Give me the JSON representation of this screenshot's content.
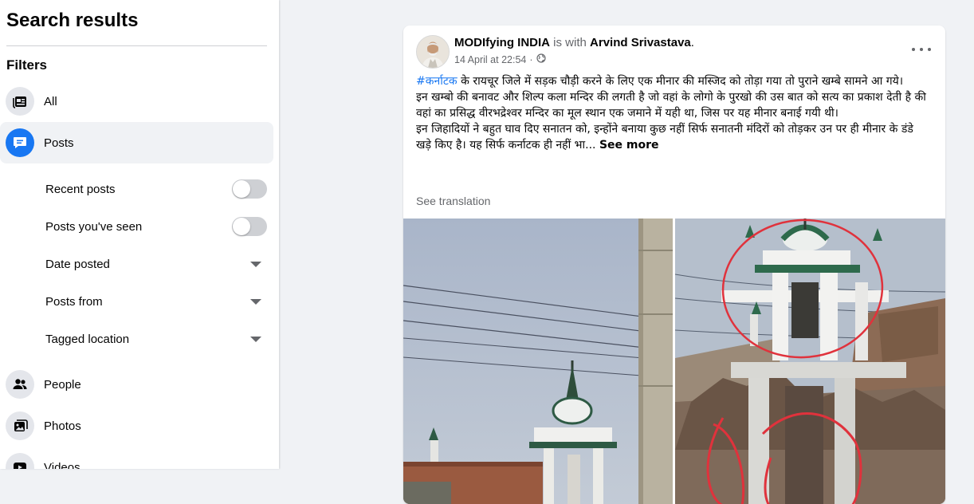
{
  "sidebar": {
    "title": "Search results",
    "filters_heading": "Filters",
    "categories": [
      {
        "label": "All",
        "icon": "feed-icon"
      },
      {
        "label": "Posts",
        "icon": "posts-icon"
      },
      {
        "label": "People",
        "icon": "people-icon"
      },
      {
        "label": "Photos",
        "icon": "photos-icon"
      },
      {
        "label": "Videos",
        "icon": "videos-icon"
      }
    ],
    "post_filters": [
      {
        "label": "Recent posts",
        "control": "toggle",
        "value": "off"
      },
      {
        "label": "Posts you've seen",
        "control": "toggle",
        "value": "off"
      },
      {
        "label": "Date posted",
        "control": "dropdown"
      },
      {
        "label": "Posts from",
        "control": "dropdown"
      },
      {
        "label": "Tagged location",
        "control": "dropdown"
      }
    ]
  },
  "post": {
    "author": "MODIfying INDIA",
    "with_text": "is with",
    "tagged": "Arvind Srivastava",
    "timestamp": "14 April at 22:54",
    "audience_icon": "globe-icon",
    "hashtag": "#कर्नाटक",
    "text_line1": " के रायचूर जिले में सड़क चौड़ी करने के लिए एक मीनार की मस्जिद को तोड़ा गया तो पुराने खम्बे सामने आ गये।",
    "text_line2": "इन खम्बो की बनावट और शिल्प कला मन्दिर की लगती है जो वहां के लोगो के पुरखो की उस बात को सत्य का प्रकाश देती है की वहां का प्रसिद्ध  वीरभद्रेश्वर मन्दिर का मूल स्थान एक जमाने में यही था, जिस पर यह मीनार बनाई गयी थी।",
    "text_line3": "इन जिहादियों ने बहुत घाव दिए सनातन को, इन्होंने बनाया कुछ नहीं सिर्फ सनातनी मंदिरों को तोड़कर उन पर ही मीनार के डंडे खड़े किए है। यह सिर्फ कर्नाटक ही नहीं भा...",
    "see_more": "See more",
    "see_translation": "See translation"
  },
  "colors": {
    "accent": "#1877f2",
    "page_bg": "#f0f2f5",
    "muted_text": "#65676b",
    "annotation_circle": "#e0323c"
  }
}
